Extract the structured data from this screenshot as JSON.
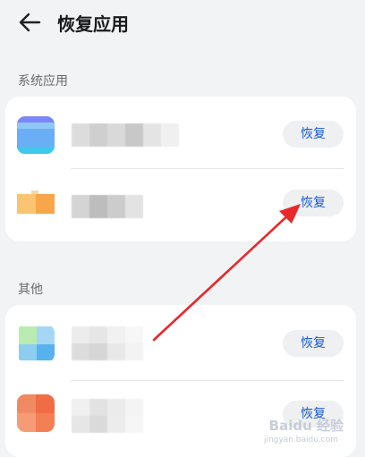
{
  "header": {
    "title": "恢复应用"
  },
  "sections": [
    {
      "title": "系统应用",
      "items": [
        {
          "icon": "blue-folder-app-icon",
          "button_label": "恢复"
        },
        {
          "icon": "orange-app-icon",
          "button_label": "恢复"
        }
      ]
    },
    {
      "title": "其他",
      "items": [
        {
          "icon": "green-blue-app-icon",
          "button_label": "恢复"
        },
        {
          "icon": "red-orange-app-icon",
          "button_label": "恢复"
        }
      ]
    }
  ],
  "annotation": {
    "color": "#e8282b"
  },
  "watermark": {
    "text": "Baidu 经验",
    "url_text": "jingyan.baidu.com"
  },
  "colors": {
    "accent": "#1a5ad8",
    "background": "#f1f3f5",
    "card": "#ffffff"
  }
}
